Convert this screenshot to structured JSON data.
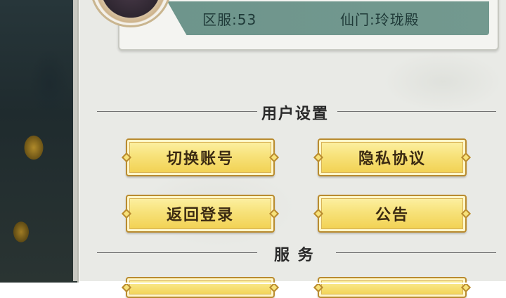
{
  "profile": {
    "server_label": "区服",
    "server_value": "53",
    "sect_label": "仙门",
    "sect_value": "玲珑殿"
  },
  "sections": {
    "user_settings": "用户设置",
    "services": "服 务"
  },
  "buttons": {
    "switch_account": "切换账号",
    "privacy_policy": "隐私协议",
    "return_login": "返回登录",
    "announcement": "公告"
  },
  "colors": {
    "button_fill": "#f7e27a",
    "button_border": "#b98b2f",
    "info_strip": "#6e958c",
    "panel_bg": "#e9eae6"
  }
}
